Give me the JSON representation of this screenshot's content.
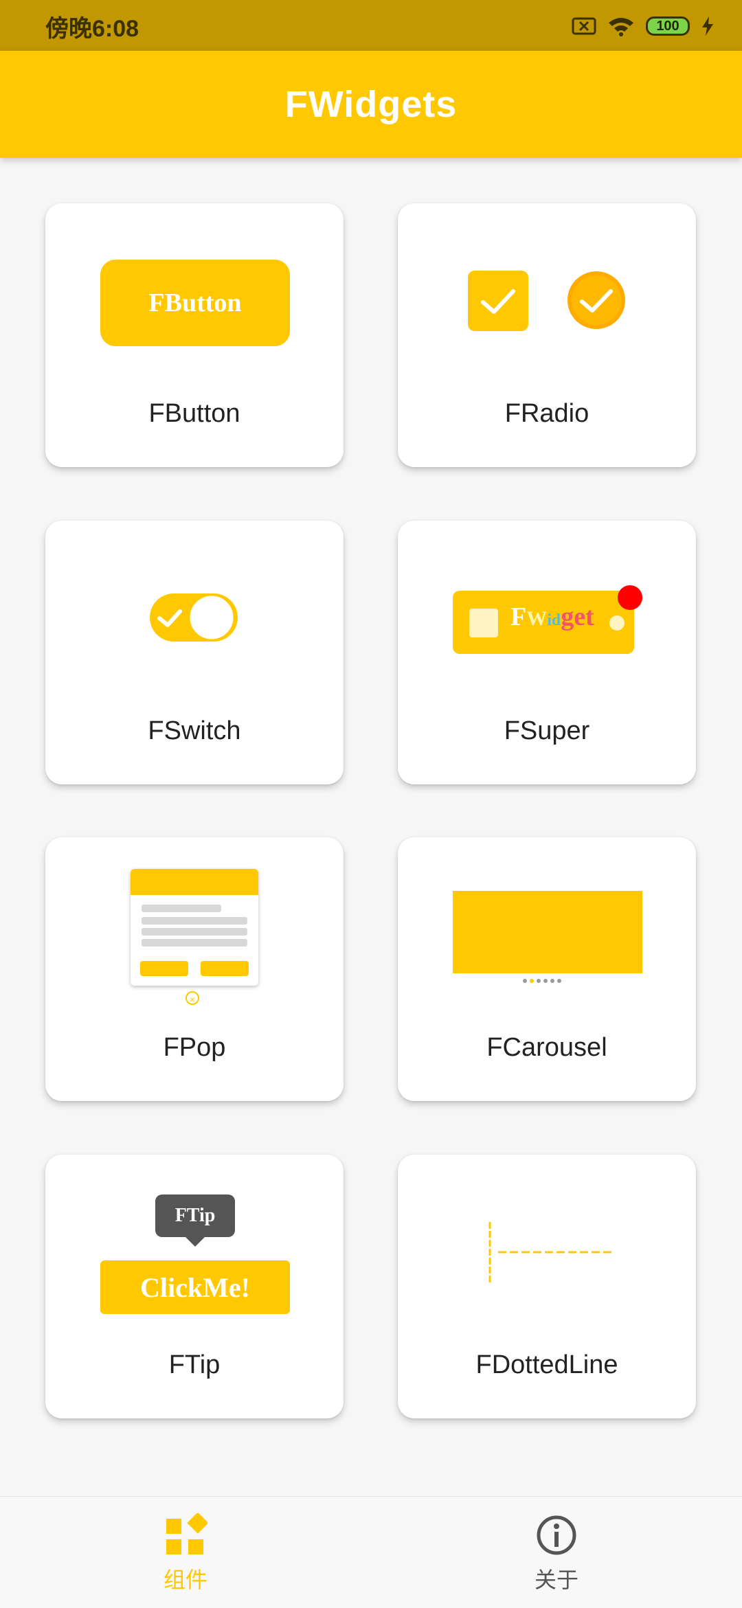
{
  "status_bar": {
    "time": "傍晚6:08",
    "battery": "100",
    "icons": [
      "sim-x-icon",
      "wifi-icon",
      "battery-icon",
      "charging-bolt-icon"
    ]
  },
  "app_bar": {
    "title": "FWidgets"
  },
  "accent_color": "#FFC800",
  "cards": [
    {
      "label": "FButton",
      "preview_text": "FButton"
    },
    {
      "label": "FRadio"
    },
    {
      "label": "FSwitch"
    },
    {
      "label": "FSuper",
      "preview_text_parts": [
        "F",
        "W",
        "id",
        "get"
      ]
    },
    {
      "label": "FPop"
    },
    {
      "label": "FCarousel"
    },
    {
      "label": "FTip",
      "tip_text": "FTip",
      "button_text": "ClickMe!"
    },
    {
      "label": "FDottedLine"
    }
  ],
  "bottom_nav": {
    "items": [
      {
        "label": "组件",
        "icon": "widgets-icon",
        "active": true
      },
      {
        "label": "关于",
        "icon": "info-icon",
        "active": false
      }
    ]
  }
}
